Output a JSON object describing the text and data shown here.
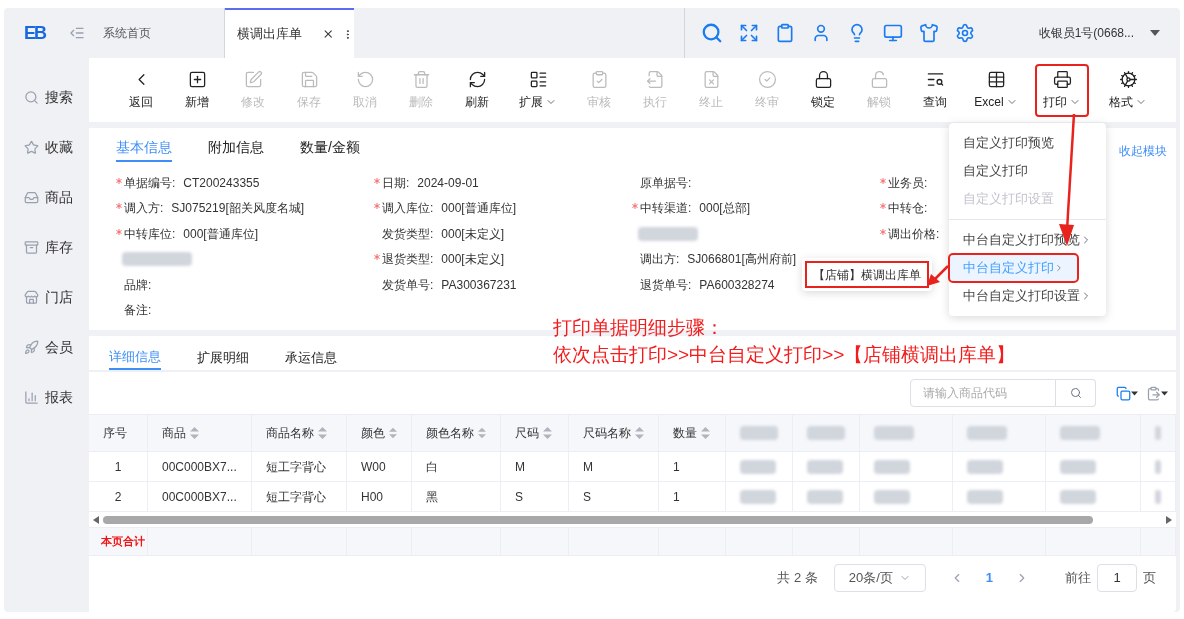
{
  "logo": "EB",
  "sidebar": {
    "items": [
      {
        "label": "搜索"
      },
      {
        "label": "收藏"
      },
      {
        "label": "商品"
      },
      {
        "label": "库存"
      },
      {
        "label": "门店"
      },
      {
        "label": "会员"
      },
      {
        "label": "报表"
      }
    ]
  },
  "tabs": [
    {
      "label": "系统首页",
      "selected": false
    },
    {
      "label": "横调出库单",
      "selected": true
    }
  ],
  "user": "收银员1号(0668...",
  "toolbar": [
    {
      "label": "返回",
      "disabled": false,
      "dropdown": false,
      "highlighted": false
    },
    {
      "label": "新增",
      "disabled": false,
      "dropdown": false,
      "highlighted": false
    },
    {
      "label": "修改",
      "disabled": true,
      "dropdown": false,
      "highlighted": false
    },
    {
      "label": "保存",
      "disabled": true,
      "dropdown": false,
      "highlighted": false
    },
    {
      "label": "取消",
      "disabled": true,
      "dropdown": false,
      "highlighted": false
    },
    {
      "label": "删除",
      "disabled": true,
      "dropdown": false,
      "highlighted": false
    },
    {
      "label": "刷新",
      "disabled": false,
      "dropdown": false,
      "highlighted": false
    },
    {
      "label": "扩展",
      "disabled": false,
      "dropdown": true,
      "highlighted": false
    },
    {
      "label": "审核",
      "disabled": true,
      "dropdown": false,
      "highlighted": false
    },
    {
      "label": "执行",
      "disabled": true,
      "dropdown": false,
      "highlighted": false
    },
    {
      "label": "终止",
      "disabled": true,
      "dropdown": false,
      "highlighted": false
    },
    {
      "label": "终审",
      "disabled": true,
      "dropdown": false,
      "highlighted": false
    },
    {
      "label": "锁定",
      "disabled": false,
      "dropdown": false,
      "highlighted": false
    },
    {
      "label": "解锁",
      "disabled": true,
      "dropdown": false,
      "highlighted": false
    },
    {
      "label": "查询",
      "disabled": false,
      "dropdown": false,
      "highlighted": false
    },
    {
      "label": "Excel",
      "disabled": false,
      "dropdown": true,
      "highlighted": false
    },
    {
      "label": "打印",
      "disabled": false,
      "dropdown": true,
      "highlighted": true
    },
    {
      "label": "格式",
      "disabled": false,
      "dropdown": true,
      "highlighted": false
    }
  ],
  "form": {
    "tabs": [
      {
        "label": "基本信息",
        "selected": true
      },
      {
        "label": "附加信息",
        "selected": false
      },
      {
        "label": "数量/金额",
        "selected": false
      }
    ],
    "collapse_link": "收起模块",
    "columns": [
      [
        {
          "kind": "field",
          "label": "单据编号:",
          "value": "CT200243355",
          "required": true
        },
        {
          "kind": "field",
          "label": "调入方:",
          "value": "SJ075219[韶关风度名城]",
          "required": true
        },
        {
          "kind": "field",
          "label": "中转库位:",
          "value": "000[普通库位]",
          "required": true
        },
        {
          "kind": "blurred"
        },
        {
          "kind": "field",
          "label": "品牌:",
          "required": false
        },
        {
          "kind": "field",
          "label": "备注:",
          "required": false
        }
      ],
      [
        {
          "kind": "field",
          "label": "日期:",
          "value": "2024-09-01",
          "required": true
        },
        {
          "kind": "field",
          "label": "调入库位:",
          "value": "000[普通库位]",
          "required": true
        },
        {
          "kind": "field",
          "label": "发货类型:",
          "value": "000[未定义]",
          "required": false
        },
        {
          "kind": "field",
          "label": "退货类型:",
          "value": "000[未定义]",
          "required": true
        },
        {
          "kind": "field",
          "label": "发货单号:",
          "value": "PA300367231",
          "required": false
        }
      ],
      [
        {
          "kind": "field",
          "label": "原单据号:",
          "required": false
        },
        {
          "kind": "field",
          "label": "中转渠道:",
          "value": "000[总部]",
          "required": true
        },
        {
          "kind": "blurred"
        },
        {
          "kind": "field",
          "label": "调出方:",
          "value": "SJ066801[高州府前]",
          "required": false
        },
        {
          "kind": "field",
          "label": "退货单号:",
          "value": "PA600328274",
          "required": false
        }
      ],
      [
        {
          "kind": "field",
          "label": "业务员:",
          "required": true
        },
        {
          "kind": "field",
          "label": "中转仓:",
          "required": true
        },
        {
          "kind": "field",
          "label": "调出价格:",
          "required": true
        }
      ]
    ]
  },
  "detail": {
    "tabs": [
      {
        "label": "详细信息",
        "selected": true
      },
      {
        "label": "扩展明细",
        "selected": false
      },
      {
        "label": "承运信息",
        "selected": false
      }
    ],
    "search": {
      "placeholder": "请输入商品代码"
    },
    "table": {
      "columns": [
        {
          "kind": "plain",
          "label": "序号"
        },
        {
          "kind": "sortable",
          "label": "商品"
        },
        {
          "kind": "sortable",
          "label": "商品名称"
        },
        {
          "kind": "sortable",
          "label": "颜色"
        },
        {
          "kind": "sortable",
          "label": "颜色名称"
        },
        {
          "kind": "sortable",
          "label": "尺码"
        },
        {
          "kind": "sortable",
          "label": "尺码名称"
        },
        {
          "kind": "sortable",
          "label": "数量"
        },
        {
          "kind": "blurred"
        },
        {
          "kind": "blurred"
        },
        {
          "kind": "blurred"
        },
        {
          "kind": "blurred"
        },
        {
          "kind": "blurred"
        },
        {
          "kind": "blurred"
        }
      ],
      "rows": [
        {
          "cells": [
            "1",
            "00C000BX7...",
            "短工字背心",
            "W00",
            "白",
            "M",
            "M",
            "1"
          ]
        },
        {
          "cells": [
            "2",
            "00C000BX7...",
            "短工字背心",
            "H00",
            "黑",
            "S",
            "S",
            "1"
          ]
        }
      ],
      "total_label": "本页合计"
    },
    "pagination": {
      "total": "共 2 条",
      "page_size": "20条/页",
      "current": "1",
      "goto_label": "前往",
      "goto_value": "1",
      "page_unit": "页"
    }
  },
  "print_menu": {
    "sections": [
      [
        {
          "label": "自定义打印预览",
          "disabled": false,
          "submenu": false,
          "selected": false
        },
        {
          "label": "自定义打印",
          "disabled": false,
          "submenu": false,
          "selected": false
        },
        {
          "label": "自定义打印设置",
          "disabled": true,
          "submenu": false,
          "selected": false
        }
      ],
      [
        {
          "label": "中台自定义打印预览",
          "disabled": false,
          "submenu": true,
          "selected": false
        },
        {
          "label": "中台自定义打印",
          "disabled": false,
          "submenu": true,
          "selected": true
        },
        {
          "label": "中台自定义打印设置",
          "disabled": false,
          "submenu": true,
          "selected": false
        }
      ]
    ],
    "submenu": [
      {
        "label": "【店铺】横调出库单",
        "highlighted": true
      }
    ]
  },
  "annotation": [
    "打印单据明细步骤：",
    "依次点击打印>>中台自定义打印>>【店铺横调出库单】"
  ]
}
